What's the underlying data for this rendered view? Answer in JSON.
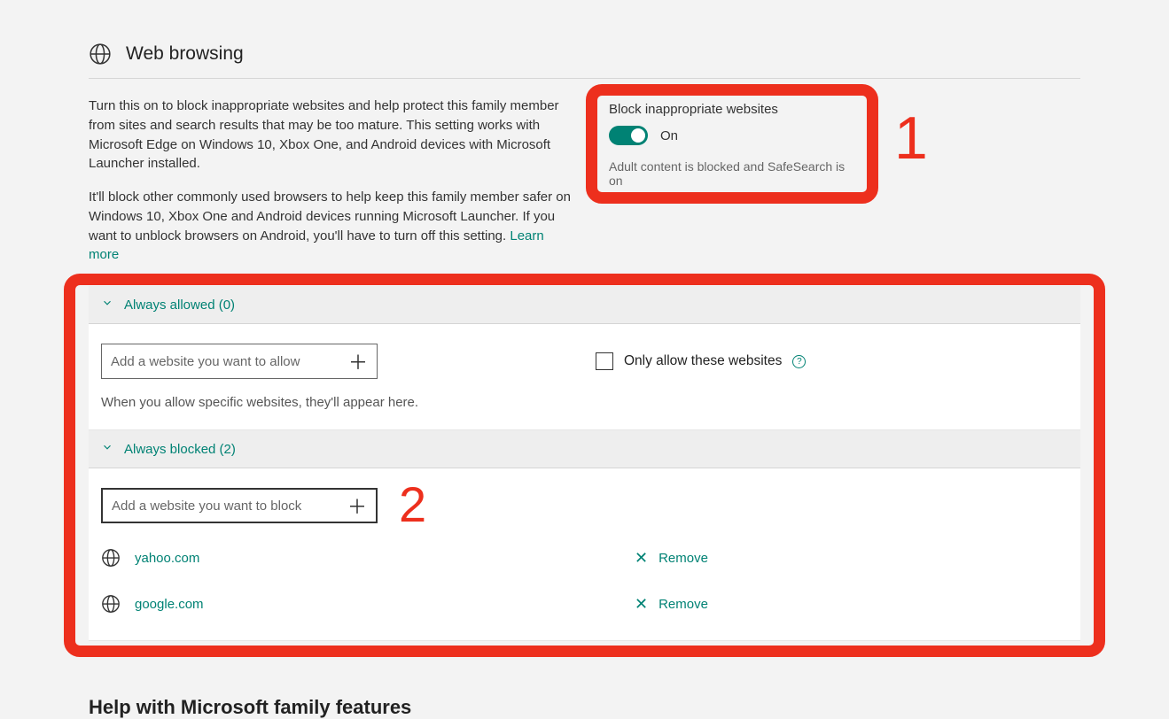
{
  "section": {
    "title": "Web browsing",
    "paragraph1": "Turn this on to block inappropriate websites and help protect this family member from sites and search results that may be too mature. This setting works with Microsoft Edge on Windows 10, Xbox One, and Android devices with Microsoft Launcher installed.",
    "paragraph2_pre": "It'll block other commonly used browsers to help keep this family member safer on Windows 10, Xbox One and Android devices running Microsoft Launcher. If you want to unblock browsers on Android, you'll have to turn off this setting. ",
    "learn_more": "Learn more"
  },
  "toggle": {
    "title": "Block inappropriate websites",
    "state": "On",
    "desc": "Adult content is blocked and SafeSearch is on"
  },
  "callouts": {
    "one": "1",
    "two": "2"
  },
  "allowed": {
    "header": "Always allowed (0)",
    "placeholder": "Add a website you want to allow",
    "only_label": "Only allow these websites",
    "hint": "When you allow specific websites, they'll appear here."
  },
  "blocked": {
    "header": "Always blocked (2)",
    "placeholder": "Add a website you want to block",
    "remove_label": "Remove",
    "sites": [
      {
        "url": "yahoo.com"
      },
      {
        "url": "google.com"
      }
    ]
  },
  "help": {
    "title": "Help with Microsoft family features"
  }
}
